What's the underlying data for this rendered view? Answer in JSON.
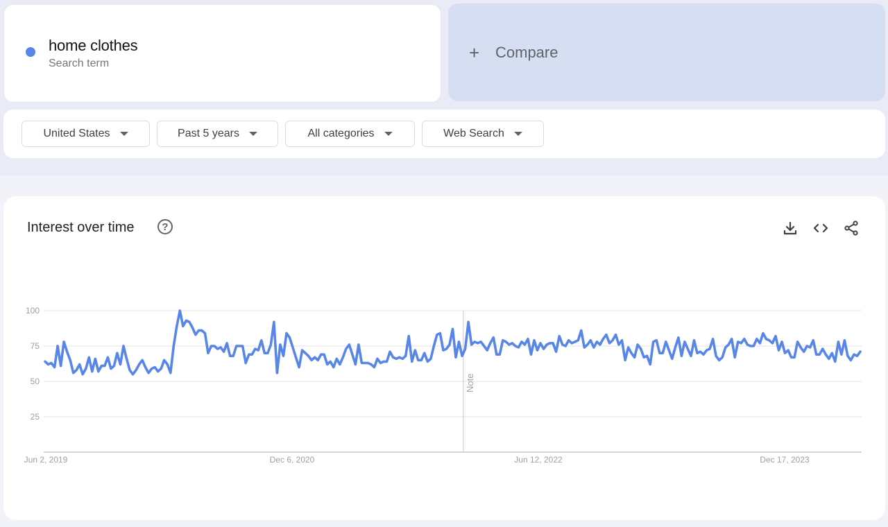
{
  "search_term": {
    "name": "home clothes",
    "subtitle": "Search term",
    "color": "#5886e8"
  },
  "compare": {
    "icon": "plus-icon",
    "label": "Compare"
  },
  "filters": [
    {
      "label": "United States",
      "icon": "caret-down-icon"
    },
    {
      "label": "Past 5 years",
      "icon": "caret-down-icon"
    },
    {
      "label": "All categories",
      "icon": "caret-down-icon"
    },
    {
      "label": "Web Search",
      "icon": "caret-down-icon"
    }
  ],
  "panel": {
    "title": "Interest over time",
    "help_icon": "?",
    "tools": [
      {
        "name": "download-icon"
      },
      {
        "name": "embed-code-icon"
      },
      {
        "name": "share-icon"
      }
    ]
  },
  "chart_data": {
    "type": "line",
    "title": "Interest over time",
    "xlabel": "",
    "ylabel": "",
    "ylim": [
      0,
      100
    ],
    "yticks": [
      25,
      50,
      75,
      100
    ],
    "xticks": [
      "Jun 2, 2019",
      "Dec 6, 2020",
      "Jun 12, 2022",
      "Dec 17, 2023"
    ],
    "grid": true,
    "annotation": {
      "label": "Note",
      "position_fraction": 0.513
    },
    "series": [
      {
        "name": "home clothes",
        "color": "#5886e8",
        "values": [
          64,
          62,
          63,
          60,
          75,
          61,
          78,
          71,
          65,
          56,
          58,
          62,
          55,
          59,
          67,
          57,
          66,
          57,
          61,
          61,
          67,
          59,
          61,
          70,
          62,
          75,
          66,
          58,
          55,
          58,
          62,
          65,
          60,
          56,
          59,
          60,
          57,
          59,
          65,
          62,
          56,
          75,
          89,
          100,
          89,
          93,
          92,
          88,
          83,
          86,
          86,
          84,
          70,
          75,
          75,
          73,
          74,
          71,
          77,
          68,
          68,
          75,
          75,
          75,
          63,
          69,
          69,
          73,
          72,
          79,
          70,
          70,
          76,
          92,
          56,
          76,
          68,
          84,
          81,
          74,
          67,
          60,
          72,
          70,
          68,
          65,
          67,
          65,
          69,
          69,
          62,
          64,
          60,
          66,
          62,
          67,
          73,
          76,
          69,
          62,
          76,
          63,
          63,
          63,
          62,
          60,
          66,
          63,
          64,
          64,
          71,
          67,
          66,
          67,
          66,
          68,
          82,
          64,
          72,
          65,
          65,
          70,
          64,
          66,
          75,
          83,
          84,
          72,
          73,
          76,
          87,
          67,
          78,
          68,
          73,
          92,
          76,
          78,
          77,
          78,
          75,
          72,
          77,
          81,
          69,
          69,
          79,
          78,
          76,
          77,
          75,
          74,
          78,
          76,
          80,
          69,
          79,
          72,
          77,
          73,
          76,
          77,
          77,
          71,
          82,
          76,
          75,
          79,
          77,
          78,
          79,
          86,
          74,
          76,
          79,
          74,
          78,
          76,
          80,
          83,
          77,
          79,
          83,
          76,
          79,
          65,
          74,
          70,
          67,
          76,
          73,
          67,
          68,
          62,
          78,
          79,
          70,
          70,
          78,
          72,
          66,
          74,
          81,
          68,
          78,
          73,
          68,
          79,
          70,
          71,
          69,
          72,
          73,
          80,
          68,
          65,
          67,
          74,
          76,
          80,
          67,
          78,
          77,
          80,
          76,
          75,
          75,
          80,
          77,
          84,
          80,
          79,
          77,
          82,
          72,
          78,
          70,
          72,
          67,
          67,
          78,
          74,
          71,
          75,
          74,
          79,
          69,
          69,
          73,
          69,
          66,
          70,
          64,
          78,
          69,
          79,
          68,
          65,
          69,
          68,
          71
        ]
      }
    ]
  }
}
